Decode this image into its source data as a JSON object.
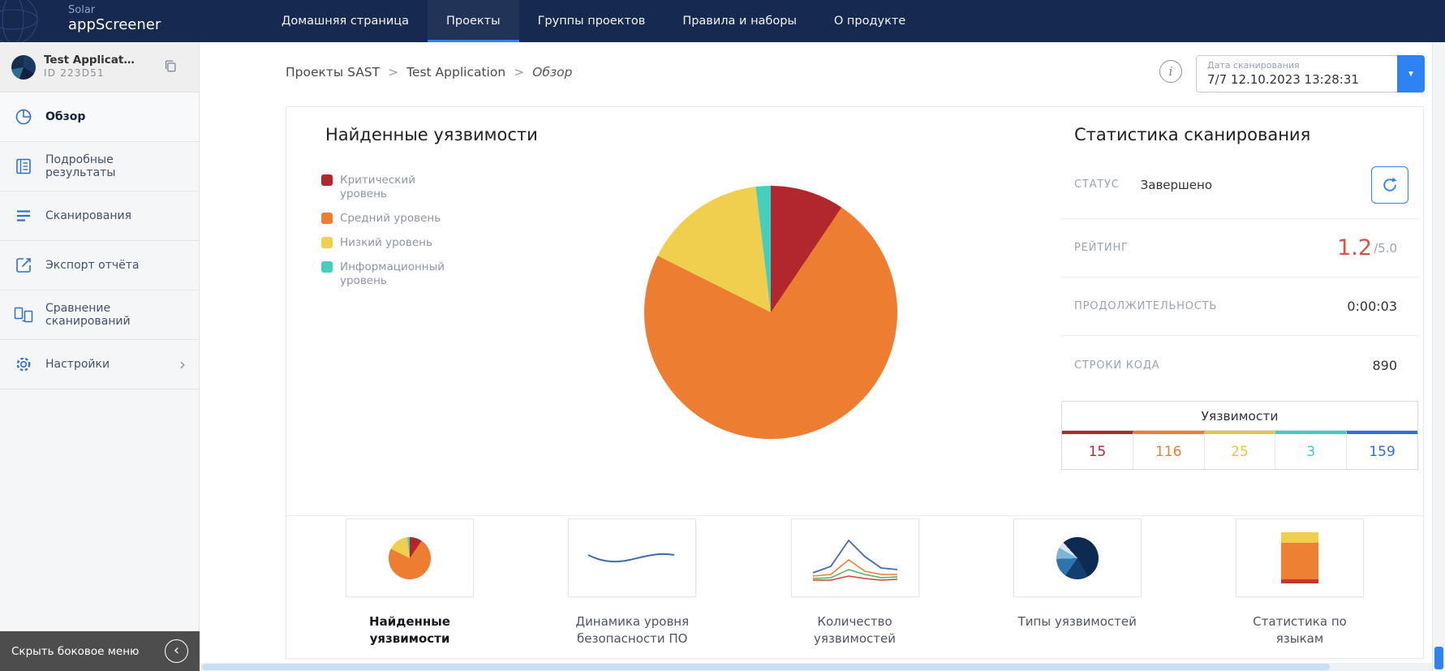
{
  "app": {
    "logo_line1": "Solar",
    "logo_line2": "appScreener"
  },
  "nav": {
    "items": [
      {
        "label": "Домашняя страница",
        "active": false
      },
      {
        "label": "Проекты",
        "active": true
      },
      {
        "label": "Группы проектов",
        "active": false
      },
      {
        "label": "Правила и наборы",
        "active": false
      },
      {
        "label": "О продукте",
        "active": false
      }
    ]
  },
  "sidebar": {
    "project_name": "Test Applicat…",
    "project_id": "ID 223D51",
    "items": [
      {
        "label": "Обзор",
        "active": true
      },
      {
        "label": "Подробные результаты"
      },
      {
        "label": "Сканирования"
      },
      {
        "label": "Экспорт отчёта"
      },
      {
        "label": "Сравнение сканирований"
      },
      {
        "label": "Настройки",
        "has_submenu": true
      }
    ],
    "collapse_label": "Скрыть боковое меню"
  },
  "breadcrumb": {
    "items": [
      "Проекты SAST",
      "Test Application",
      "Обзор"
    ],
    "separator": ">"
  },
  "scan_date": {
    "label": "Дата сканирования",
    "value": "7/7 12.10.2023 13:28:31"
  },
  "chart_data": {
    "type": "pie",
    "title": "Найденные уязвимости",
    "labels": [
      "Критический уровень",
      "Средний уровень",
      "Низкий уровень",
      "Информационный уровень"
    ],
    "values": [
      15,
      116,
      25,
      3
    ],
    "colors": [
      "#b2262d",
      "#ed7d31",
      "#f0cf4e",
      "#45cfbd"
    ],
    "legend_position": "left",
    "total": 159
  },
  "stats": {
    "title": "Статистика сканирования",
    "status": {
      "label": "СТАТУС",
      "value": "Завершено"
    },
    "rating": {
      "label": "РЕЙТИНГ",
      "value": "1.2",
      "max": "/5.0"
    },
    "duration": {
      "label": "ПРОДОЛЖИТЕЛЬНОСТЬ",
      "value": "0:00:03"
    },
    "lines_of_code": {
      "label": "СТРОКИ КОДА",
      "value": "890"
    },
    "vulns": {
      "title": "Уязвимости",
      "counts": [
        "15",
        "116",
        "25",
        "3",
        "159"
      ],
      "colors": [
        "#b2262d",
        "#ed7d31",
        "#e9c53b",
        "#3fcdbc",
        "#2f6fd8"
      ]
    }
  },
  "thumbnails": [
    {
      "label": "Найденные уязвимости",
      "active": true
    },
    {
      "label": "Динамика уровня безопасности ПО",
      "active": false
    },
    {
      "label": "Количество уязвимостей",
      "active": false
    },
    {
      "label": "Типы уязвимостей",
      "active": false
    },
    {
      "label": "Статистика по языкам",
      "active": false
    }
  ],
  "icons": {
    "info": "i",
    "dropdown": "▼",
    "chevron_right": "›",
    "chevron_left": "‹"
  },
  "colors": {
    "accent_blue": "#2e82f2",
    "nav_bg": "#16294e",
    "rating_red": "#e04f43"
  }
}
